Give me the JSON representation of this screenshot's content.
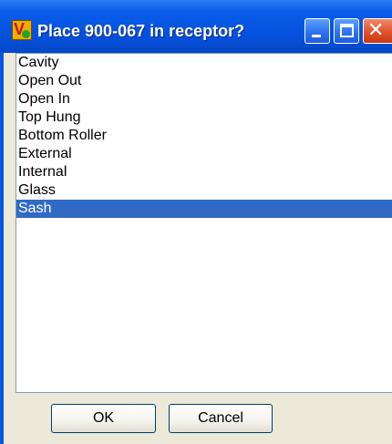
{
  "window": {
    "title": "Place 900-067 in receptor?"
  },
  "titlebar": {
    "icons": [
      "app-icon",
      "minimize-icon",
      "maximize-icon",
      "close-icon"
    ]
  },
  "list": {
    "items": [
      {
        "label": "Cavity",
        "selected": false
      },
      {
        "label": "Open Out",
        "selected": false
      },
      {
        "label": "Open In",
        "selected": false
      },
      {
        "label": "Top Hung",
        "selected": false
      },
      {
        "label": "Bottom Roller",
        "selected": false
      },
      {
        "label": "External",
        "selected": false
      },
      {
        "label": "Internal",
        "selected": false
      },
      {
        "label": "Glass",
        "selected": false
      },
      {
        "label": "Sash",
        "selected": true
      }
    ]
  },
  "buttons": {
    "ok_label": "OK",
    "cancel_label": "Cancel"
  },
  "colors": {
    "titlebar": "#0553e0",
    "selection": "#316ac5",
    "dialog_face": "#ece9d8",
    "close_button": "#e0502c"
  }
}
